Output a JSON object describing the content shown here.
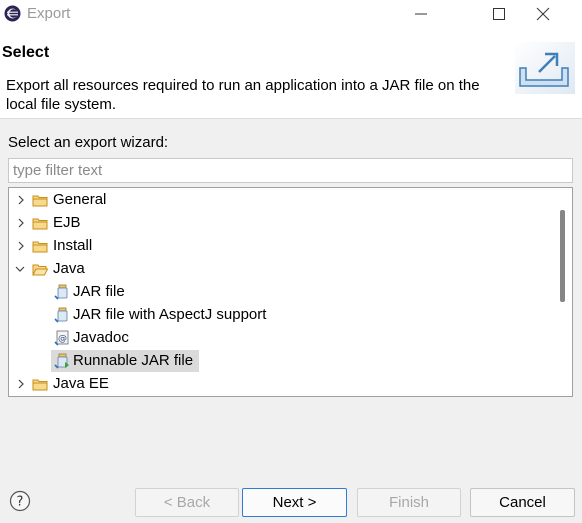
{
  "window": {
    "title": "Export",
    "icons": {
      "app": "eclipse-icon",
      "minimize": "minimize-icon",
      "maximize": "maximize-icon",
      "close": "close-icon"
    }
  },
  "header": {
    "title": "Select",
    "description": "Export all resources required to run an application into a JAR file on the local file system.",
    "banner_icon": "export-wizard-icon"
  },
  "wizard": {
    "label": "Select an export wizard:",
    "filter_placeholder": "type filter text",
    "filter_value": "",
    "tree": [
      {
        "label": "General",
        "level": 0,
        "expanded": false,
        "icon": "folder-icon"
      },
      {
        "label": "EJB",
        "level": 0,
        "expanded": false,
        "icon": "folder-icon"
      },
      {
        "label": "Install",
        "level": 0,
        "expanded": false,
        "icon": "folder-icon"
      },
      {
        "label": "Java",
        "level": 0,
        "expanded": true,
        "icon": "folder-icon"
      },
      {
        "label": "JAR file",
        "level": 1,
        "icon": "jar-file-icon"
      },
      {
        "label": "JAR file with AspectJ support",
        "level": 1,
        "icon": "jar-file-icon"
      },
      {
        "label": "Javadoc",
        "level": 1,
        "icon": "javadoc-icon"
      },
      {
        "label": "Runnable JAR file",
        "level": 1,
        "icon": "runnable-jar-icon",
        "selected": true
      },
      {
        "label": "Java EE",
        "level": 0,
        "expanded": false,
        "icon": "folder-icon"
      }
    ]
  },
  "buttons": {
    "back": "< Back",
    "next": "Next >",
    "finish": "Finish",
    "cancel": "Cancel",
    "help_icon": "help-icon"
  },
  "colors": {
    "folder": "#e8b74a",
    "selection": "#dadada",
    "primary_border": "#2f7bd6",
    "banner_blue": "#4a90c8"
  }
}
